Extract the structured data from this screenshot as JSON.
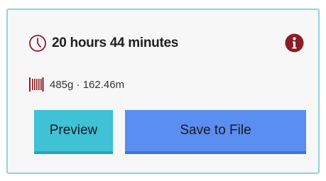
{
  "print_info": {
    "time_estimate": "20 hours 44 minutes",
    "filament_summary": "485g · 162.46m"
  },
  "actions": {
    "preview_label": "Preview",
    "save_label": "Save to File"
  },
  "icons": {
    "time": "clock-icon",
    "filament": "filament-spool-icon",
    "info": "info-icon"
  },
  "colors": {
    "accent_dark_red": "#8b1d24",
    "preview_button": "#3fc1d6",
    "save_button": "#5a8ef0",
    "card_border": "#8fd3e0"
  }
}
